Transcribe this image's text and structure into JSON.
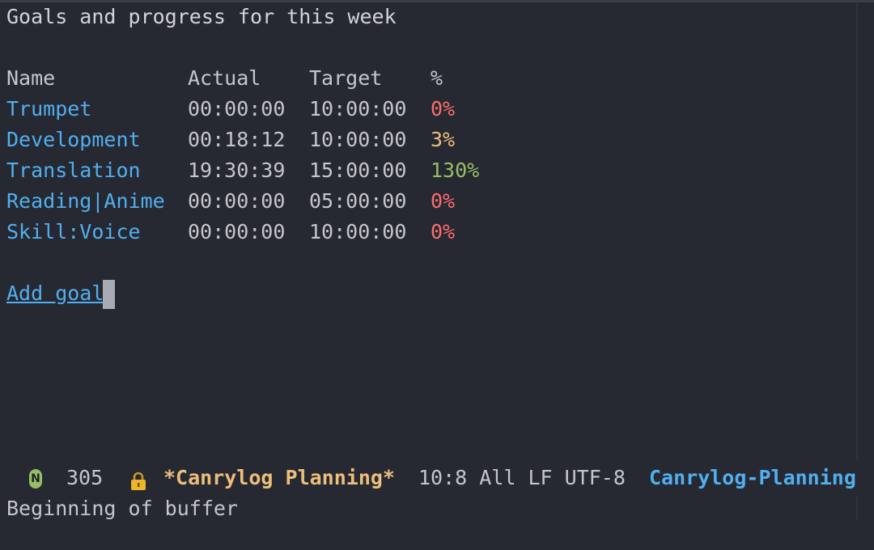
{
  "title": "Goals and progress for this week",
  "table": {
    "headers": {
      "name": "Name",
      "actual": "Actual",
      "target": "Target",
      "percent": "%"
    },
    "rows": [
      {
        "name": "Trumpet",
        "actual": "00:00:00",
        "target": "10:00:00",
        "percent": "0%",
        "status_color": "#ff6c6b"
      },
      {
        "name": "Development",
        "actual": "00:18:12",
        "target": "10:00:00",
        "percent": "3%",
        "status_color": "#ecbe7b"
      },
      {
        "name": "Translation",
        "actual": "19:30:39",
        "target": "15:00:00",
        "percent": "130%",
        "status_color": "#98be65"
      },
      {
        "name": "Reading|Anime",
        "actual": "00:00:00",
        "target": "05:00:00",
        "percent": "0%",
        "status_color": "#ff6c6b"
      },
      {
        "name": "Skill:Voice",
        "actual": "00:00:00",
        "target": "10:00:00",
        "percent": "0%",
        "status_color": "#ff6c6b"
      }
    ]
  },
  "add_goal_label": "Add goal",
  "modeline": {
    "state_badge": "N",
    "line_count": "305",
    "lock_icon": "lock-icon",
    "buffer_name": "*Canrylog Planning*",
    "position": "10:8 All LF UTF-8",
    "major_mode": "Canrylog-Planning"
  },
  "echo_area": "Beginning of buffer",
  "colors": {
    "background": "#262932",
    "link": "#51afef",
    "red": "#ff6c6b",
    "yellow": "#ecbe7b",
    "green": "#98be65"
  }
}
